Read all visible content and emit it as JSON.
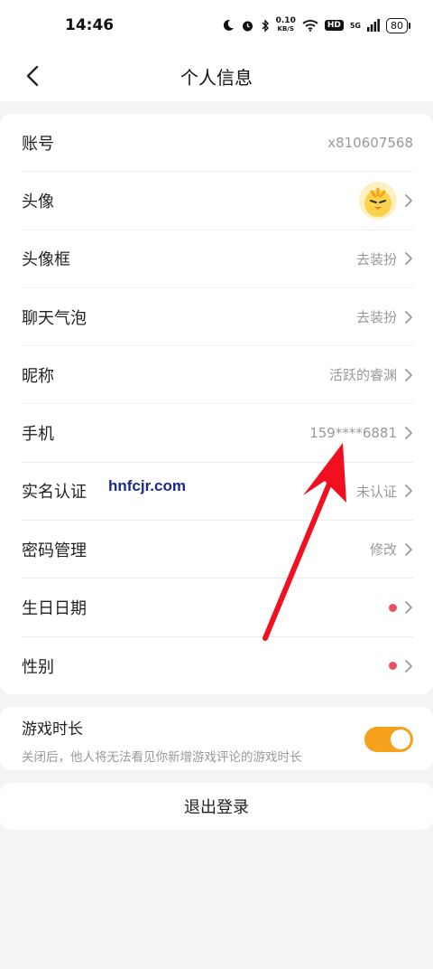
{
  "status_bar": {
    "time": "14:46",
    "speed_value": "0.10",
    "speed_unit": "KB/S",
    "hd": "HD",
    "network": "5G",
    "battery": "80"
  },
  "header": {
    "title": "个人信息",
    "back_icon": "chevron-left-icon"
  },
  "profile": {
    "rows": [
      {
        "label": "账号",
        "value": "x810607568"
      },
      {
        "label": "头像",
        "value": ""
      },
      {
        "label": "头像框",
        "value": "去装扮"
      },
      {
        "label": "聊天气泡",
        "value": "去装扮"
      },
      {
        "label": "昵称",
        "value": "活跃的睿渊"
      },
      {
        "label": "手机",
        "value": "159****6881"
      },
      {
        "label": "实名认证",
        "value": "未认证"
      },
      {
        "label": "密码管理",
        "value": "修改"
      },
      {
        "label": "生日日期",
        "value": ""
      },
      {
        "label": "性别",
        "value": ""
      }
    ]
  },
  "game_time": {
    "title": "游戏时长",
    "description": "关闭后，他人将无法看见你新增游戏评论的游戏时长",
    "toggle_on": true
  },
  "logout": {
    "label": "退出登录"
  },
  "watermark": "hnfcjr.com",
  "colors": {
    "accent": "#f5a11c",
    "dot": "#e8505b",
    "arrow": "#f01020",
    "background": "#f4f4f4"
  }
}
